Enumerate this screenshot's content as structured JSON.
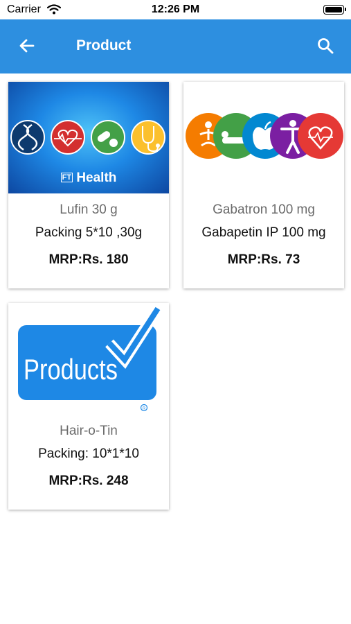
{
  "status_bar": {
    "carrier": "Carrier",
    "time": "12:26 PM"
  },
  "app_bar": {
    "title": "Product"
  },
  "products": [
    {
      "name": "Lufin 30 g",
      "packing": "Packing 5*10 ,30g",
      "mrp": "MRP:Rs. 180",
      "image_caption": "Health",
      "image_caption_mark": "FT"
    },
    {
      "name": "Gabatron 100 mg",
      "packing": "Gabapetin IP 100 mg",
      "mrp": "MRP:Rs. 73"
    },
    {
      "name": "Hair-o-Tin",
      "packing": "Packing: 10*1*10",
      "mrp": "MRP:Rs. 248",
      "image_caption": "Products"
    }
  ],
  "colors": {
    "app_bar": "#2d8fe0",
    "card_bg": "#ffffff"
  }
}
